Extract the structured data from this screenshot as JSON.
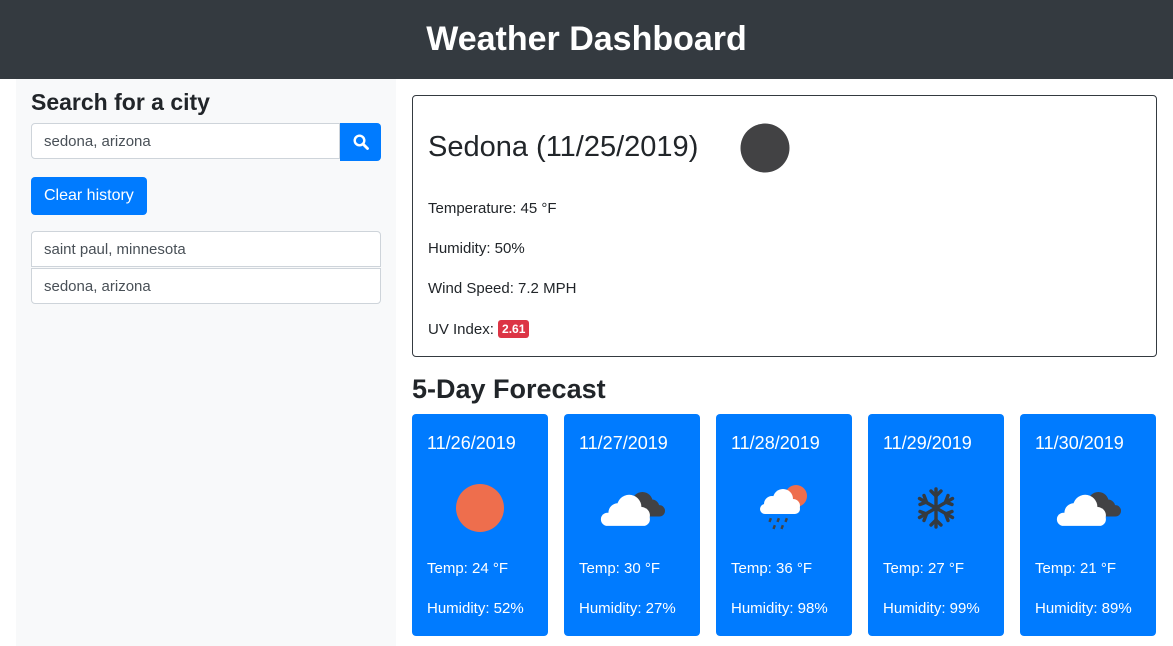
{
  "header": {
    "title": "Weather Dashboard"
  },
  "sidebar": {
    "heading": "Search for a city",
    "search_value": "sedona, arizona",
    "clear_label": "Clear history",
    "history": [
      "saint paul, minnesota",
      "sedona, arizona"
    ]
  },
  "current": {
    "title": "Sedona (11/25/2019)",
    "temperature": "Temperature: 45 °F",
    "humidity": "Humidity: 50%",
    "wind": "Wind Speed: 7.2 MPH",
    "uv_label": "UV Index:",
    "uv_value": "2.61",
    "icon": "moon-icon"
  },
  "forecast": {
    "title": "5-Day Forecast",
    "days": [
      {
        "date": "11/26/2019",
        "temp": "Temp: 24 °F",
        "humidity": "Humidity: 52%",
        "icon": "sun-icon"
      },
      {
        "date": "11/27/2019",
        "temp": "Temp: 30 °F",
        "humidity": "Humidity: 27%",
        "icon": "clouds-icon"
      },
      {
        "date": "11/28/2019",
        "temp": "Temp: 36 °F",
        "humidity": "Humidity: 98%",
        "icon": "rain-sun-icon"
      },
      {
        "date": "11/29/2019",
        "temp": "Temp: 27 °F",
        "humidity": "Humidity: 99%",
        "icon": "snowflake-icon"
      },
      {
        "date": "11/30/2019",
        "temp": "Temp: 21 °F",
        "humidity": "Humidity: 89%",
        "icon": "clouds-icon"
      }
    ]
  },
  "colors": {
    "accent": "#007bff",
    "navbar": "#343a40",
    "uv_badge": "#dc3545",
    "sun": "#ee6e4d"
  }
}
